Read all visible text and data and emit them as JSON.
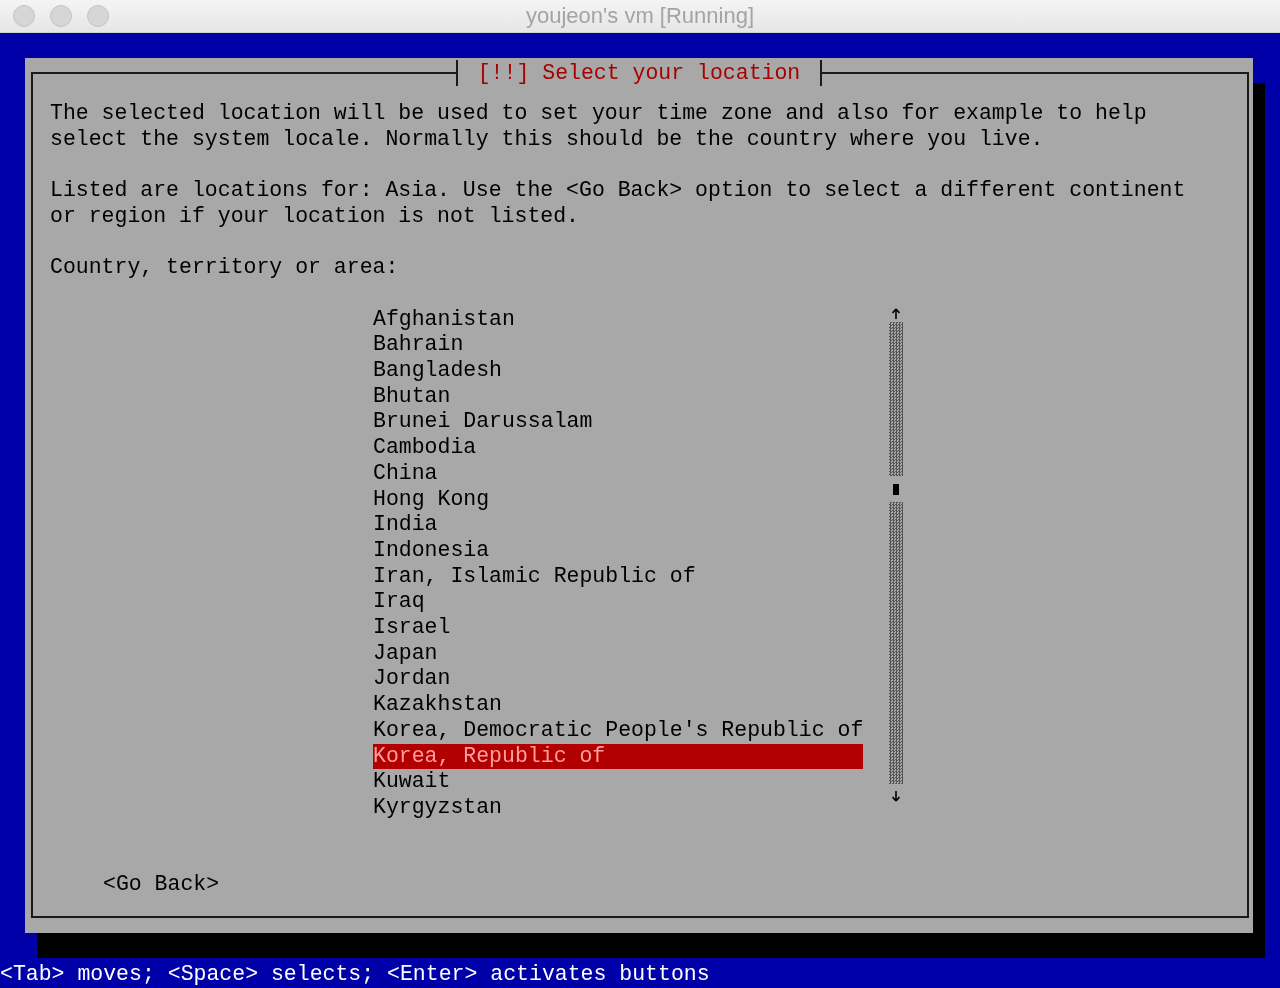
{
  "window": {
    "title": "youjeon's vm [Running]"
  },
  "dialog": {
    "title": "[!!] Select your location",
    "paragraphs": [
      "The selected location will be used to set your time zone and also for example to help select the system locale. Normally this should be the country where you live.",
      "Listed are locations for: Asia. Use the <Go Back> option to select a different continent or region if your location is not listed."
    ],
    "prompt": "Country, territory or area:",
    "items": [
      {
        "label": "Afghanistan",
        "selected": false
      },
      {
        "label": "Bahrain",
        "selected": false
      },
      {
        "label": "Bangladesh",
        "selected": false
      },
      {
        "label": "Bhutan",
        "selected": false
      },
      {
        "label": "Brunei Darussalam",
        "selected": false
      },
      {
        "label": "Cambodia",
        "selected": false
      },
      {
        "label": "China",
        "selected": false
      },
      {
        "label": "Hong Kong",
        "selected": false
      },
      {
        "label": "India",
        "selected": false
      },
      {
        "label": "Indonesia",
        "selected": false
      },
      {
        "label": "Iran, Islamic Republic of",
        "selected": false
      },
      {
        "label": "Iraq",
        "selected": false
      },
      {
        "label": "Israel",
        "selected": false
      },
      {
        "label": "Japan",
        "selected": false
      },
      {
        "label": "Jordan",
        "selected": false
      },
      {
        "label": "Kazakhstan",
        "selected": false
      },
      {
        "label": "Korea, Democratic People's Republic of",
        "selected": false
      },
      {
        "label": "Korea, Republic of",
        "selected": true
      },
      {
        "label": "Kuwait",
        "selected": false
      },
      {
        "label": "Kyrgyzstan",
        "selected": false
      }
    ],
    "buttons": [
      "<Go Back>"
    ]
  },
  "status_bar": "<Tab> moves; <Space> selects; <Enter> activates buttons"
}
